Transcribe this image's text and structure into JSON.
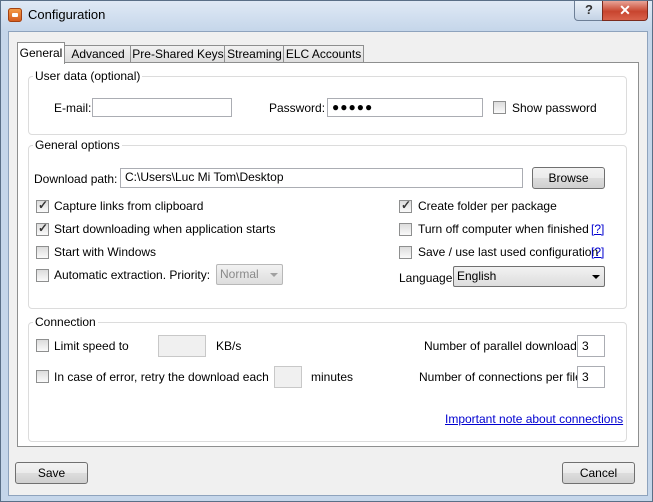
{
  "window": {
    "title": "Configuration",
    "help_label": "?",
    "close_label": "✕"
  },
  "tabs": [
    {
      "label": "General"
    },
    {
      "label": "Advanced"
    },
    {
      "label": "Pre-Shared Keys"
    },
    {
      "label": "Streaming"
    },
    {
      "label": "ELC Accounts"
    }
  ],
  "user_data": {
    "title": "User data (optional)",
    "email_label": "E-mail:",
    "email_value": "",
    "password_label": "Password:",
    "password_value": "●●●●●",
    "show_password_label": "Show password",
    "show_password_checked": false
  },
  "general_options": {
    "title": "General options",
    "download_path_label": "Download path:",
    "download_path_value": "C:\\Users\\Luc Mi Tom\\Desktop",
    "browse_label": "Browse",
    "capture_links_label": "Capture links from clipboard",
    "capture_links_checked": true,
    "start_downloading_label": "Start downloading when application starts",
    "start_downloading_checked": true,
    "start_windows_label": "Start with Windows",
    "start_windows_checked": false,
    "auto_extract_label": "Automatic extraction. Priority:",
    "auto_extract_checked": false,
    "priority_value": "Normal",
    "create_folder_label": "Create folder per package",
    "create_folder_checked": true,
    "turn_off_label": "Turn off computer when finished",
    "turn_off_checked": false,
    "save_config_label": "Save / use last used configuration",
    "save_config_checked": false,
    "help_link": "[?]",
    "language_label": "Language:",
    "language_value": "English"
  },
  "connection": {
    "title": "Connection",
    "limit_speed_label": "Limit speed to",
    "limit_speed_checked": false,
    "limit_speed_value": "",
    "speed_unit": "KB/s",
    "retry_label": "In case of error, retry the download each",
    "retry_checked": false,
    "retry_value": "",
    "minutes_label": "minutes",
    "parallel_label": "Number of parallel downloads:",
    "parallel_value": "3",
    "connections_label": "Number of connections per file:",
    "connections_value": "3",
    "note_link": "Important note about connections"
  },
  "footer": {
    "save_label": "Save",
    "cancel_label": "Cancel"
  }
}
